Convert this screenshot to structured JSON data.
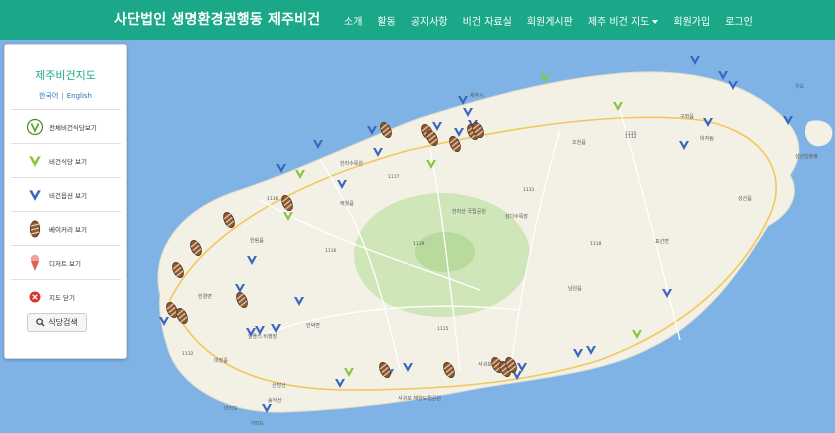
{
  "header": {
    "brand": "사단법인 생명환경권행동 제주비건",
    "nav": [
      "소개",
      "활동",
      "공지사항",
      "비건 자료실",
      "회원게시판",
      "제주 비건 지도",
      "회원가입",
      "로그인"
    ]
  },
  "panel": {
    "title": "제주비건지도",
    "lang_ko": "한국어",
    "lang_en": "English",
    "items": [
      "전체비건식당보기",
      "비건식당 보기",
      "비건옵션 보기",
      "베이커리 보기",
      "디저트 보기",
      "지도 닫기"
    ],
    "search_label": "식당검색"
  },
  "map_labels": [
    "제주시",
    "서귀포시",
    "한라산 국립공원",
    "한림읍",
    "애월읍",
    "조천읍",
    "구좌읍",
    "성산읍",
    "표선면",
    "남원읍",
    "안덕면",
    "대정읍",
    "한경면",
    "서귀포 해양도립공원",
    "성산일출봉",
    "우도",
    "추자도",
    "마라도",
    "가파도",
    "비자림",
    "알뜰리 비행장",
    "산방산",
    "송악산",
    "삼다수목장",
    "한라수목원",
    "1135",
    "1136",
    "1131",
    "1139",
    "1118",
    "1132",
    "1116",
    "1112",
    "1117",
    "1115"
  ],
  "colors": {
    "header": "#1ba888",
    "sea": "#7fb3e6",
    "land": "#f3f0e6",
    "park": "#cfe6b8",
    "vegan": "#8bc53f",
    "option": "#3b66c0",
    "bakery": "#8a5a3a"
  }
}
